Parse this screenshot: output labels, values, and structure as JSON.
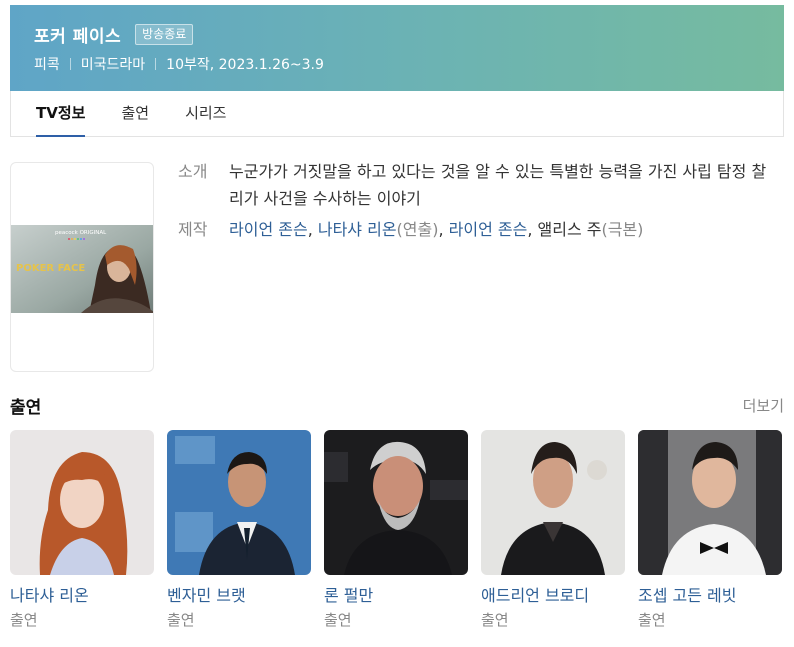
{
  "header": {
    "title": "포커 페이스",
    "badge": "방송종료",
    "meta": [
      "피콕",
      "미국드라마",
      "10부작, 2023.1.26~3.9"
    ]
  },
  "tabs": [
    {
      "label": "TV정보",
      "active": true
    },
    {
      "label": "출연",
      "active": false
    },
    {
      "label": "시리즈",
      "active": false
    }
  ],
  "poster": {
    "brand": "peacock ORIGINAL",
    "title_art": "POKER FACE"
  },
  "info": {
    "intro_label": "소개",
    "intro_text": "누군가가 거짓말을 하고 있다는 것을 알 수 있는 특별한 능력을 가진 사립 탐정 찰리가 사건을 수사하는 이야기",
    "production_label": "제작",
    "production": {
      "directors": [
        "라이언 존슨",
        "나타샤 리온"
      ],
      "director_role": "(연출)",
      "writers_linked": [
        "라이언 존슨"
      ],
      "writer_plain": "앨리스 주",
      "writer_role": "(극본)",
      "separator": ", "
    }
  },
  "cast_section": {
    "title": "출연",
    "more": "더보기"
  },
  "cast": [
    {
      "name": "나타샤 리온",
      "role": "출연"
    },
    {
      "name": "벤자민 브랫",
      "role": "출연"
    },
    {
      "name": "론 펄만",
      "role": "출연"
    },
    {
      "name": "애드리언 브로디",
      "role": "출연"
    },
    {
      "name": "조셉 고든 레빗",
      "role": "출연"
    }
  ],
  "colors": {
    "link": "#2e5f96",
    "header_start": "#5fa5c7",
    "header_end": "#76bb9f",
    "tab_underline": "#2e5fa7"
  }
}
